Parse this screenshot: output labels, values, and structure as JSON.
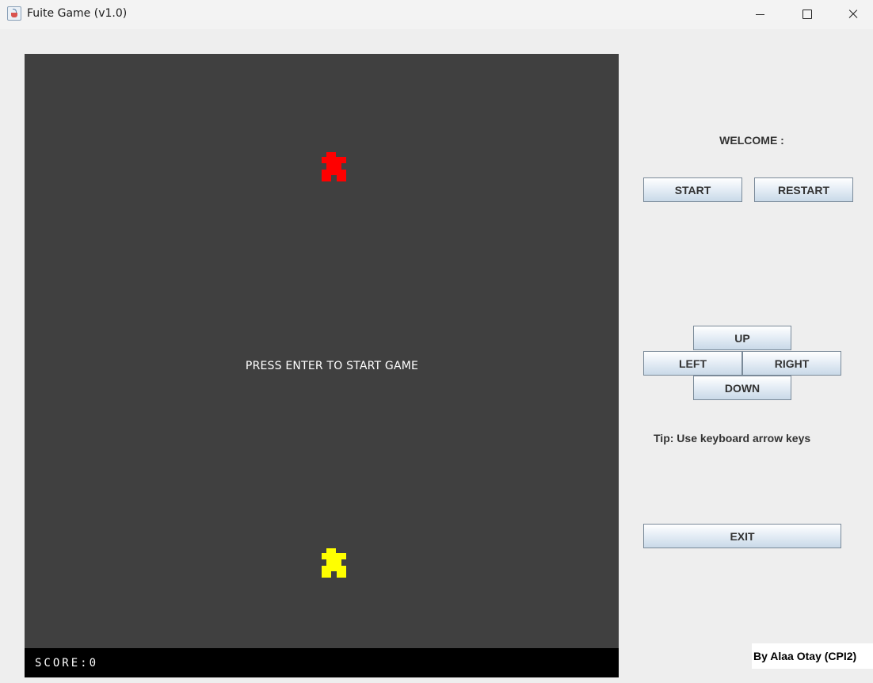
{
  "window": {
    "title": "Fuite Game (v1.0)",
    "app_icon": "java-cup-icon",
    "controls": [
      "minimize-icon",
      "maximize-icon",
      "close-icon"
    ]
  },
  "game": {
    "message": "PRESS ENTER TO START GAME",
    "score_text": "SCORE:0",
    "score": 0,
    "board_color": "#404040",
    "enemy_color": "#ff0000",
    "player_color": "#ffff00"
  },
  "panel": {
    "welcome": "WELCOME :",
    "start": "START",
    "restart": "RESTART",
    "up": "UP",
    "left": "LEFT",
    "right": "RIGHT",
    "down": "DOWN",
    "tip": "Tip: Use keyboard arrow keys",
    "exit": "EXIT",
    "credit": "By Alaa Otay (CPI2)"
  }
}
